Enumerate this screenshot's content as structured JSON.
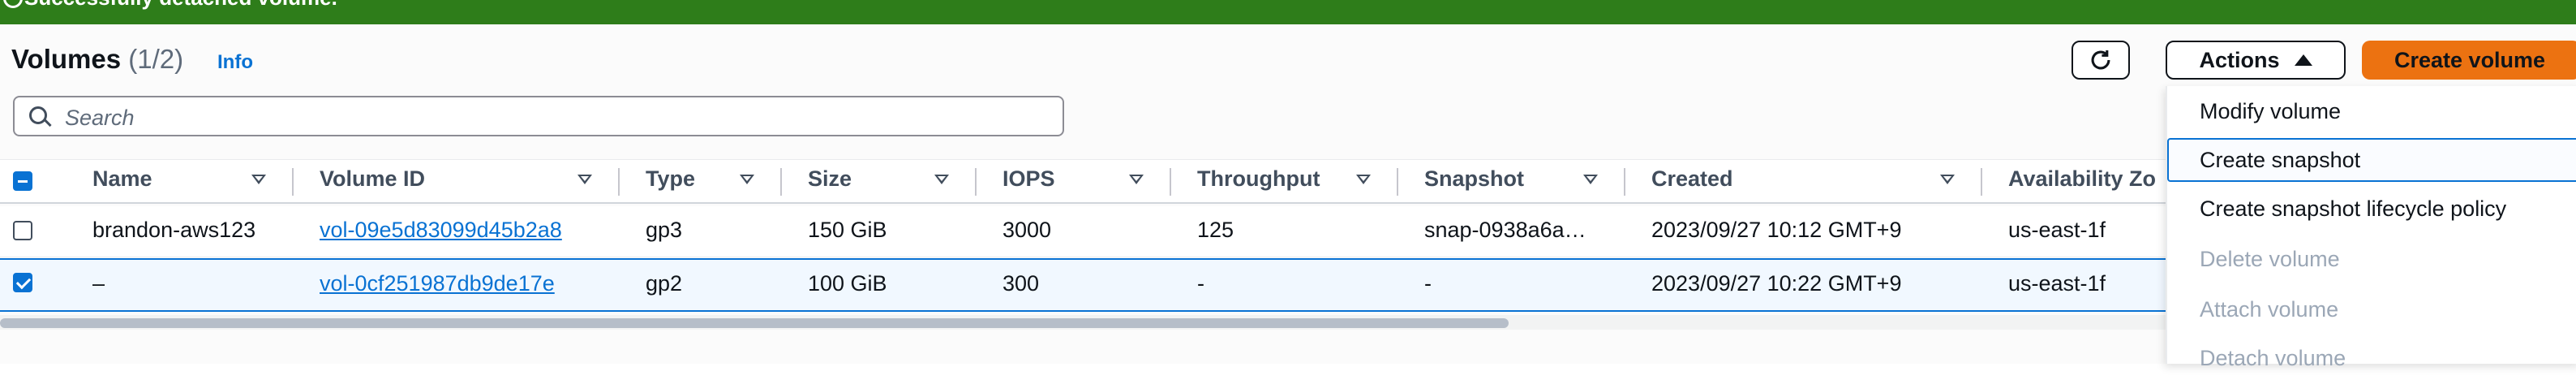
{
  "banner": {
    "text": "Successfully detached volume."
  },
  "header": {
    "title": "Volumes",
    "count": "(1/2)",
    "info": "Info",
    "actions_label": "Actions",
    "create_label": "Create volume"
  },
  "search": {
    "placeholder": "Search"
  },
  "table": {
    "columns": [
      "Name",
      "Volume ID",
      "Type",
      "Size",
      "IOPS",
      "Throughput",
      "Snapshot",
      "Created",
      "Availability Zo"
    ],
    "rows": [
      {
        "selected": false,
        "name": "brandon-aws123",
        "volume_id": "vol-09e5d83099d45b2a8",
        "type": "gp3",
        "size": "150 GiB",
        "iops": "3000",
        "throughput": "125",
        "snapshot": "snap-0938a6a…",
        "created": "2023/09/27 10:12 GMT+9",
        "az": "us-east-1f"
      },
      {
        "selected": true,
        "name": "–",
        "volume_id": "vol-0cf251987db9de17e",
        "type": "gp2",
        "size": "100 GiB",
        "iops": "300",
        "throughput": "-",
        "snapshot": "-",
        "created": "2023/09/27 10:22 GMT+9",
        "az": "us-east-1f"
      }
    ]
  },
  "actions_menu": {
    "items": [
      {
        "label": "Modify volume",
        "disabled": false
      },
      {
        "label": "Create snapshot",
        "disabled": false,
        "focused": true
      },
      {
        "label": "Create snapshot lifecycle policy",
        "disabled": false
      },
      {
        "label": "Delete volume",
        "disabled": true
      },
      {
        "label": "Attach volume",
        "disabled": true
      },
      {
        "label": "Detach volume",
        "disabled": true
      }
    ]
  },
  "colors": {
    "accent": "#0972d3",
    "primary_button": "#ec7211",
    "success_banner": "#2e7d1a"
  },
  "icons": {
    "refresh": "refresh-icon",
    "search": "search-icon",
    "caret": "caret-up-icon",
    "sort": "sort-icon"
  }
}
